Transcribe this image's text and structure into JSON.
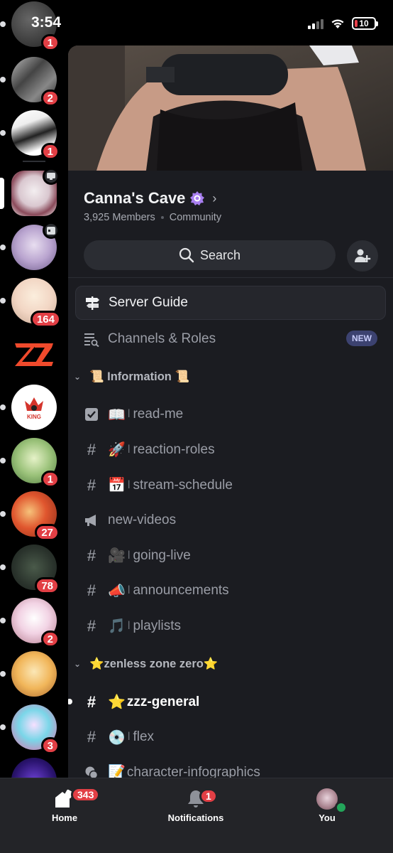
{
  "status_bar": {
    "time": "3:54",
    "battery": "10"
  },
  "server_rail": [
    {
      "badge": "1"
    },
    {
      "badge": "2"
    },
    {
      "badge": "1"
    },
    {
      "badge": ""
    },
    {
      "badge": ""
    },
    {
      "badge": "164"
    },
    {
      "badge": ""
    },
    {
      "badge": "",
      "logo_text": "KING"
    },
    {
      "badge": "1"
    },
    {
      "badge": "27"
    },
    {
      "badge": "78"
    },
    {
      "badge": "2"
    },
    {
      "badge": ""
    },
    {
      "badge": "3"
    }
  ],
  "server": {
    "name": "Canna's Cave",
    "members": "3,925 Members",
    "type": "Community",
    "search_label": "Search"
  },
  "channels": {
    "server_guide": "Server Guide",
    "channels_roles": "Channels & Roles",
    "new_pill": "NEW",
    "categories": [
      {
        "label": "📜 Information 📜",
        "items": [
          {
            "icon": "rules-icon",
            "emoji": "📖",
            "name": "read-me"
          },
          {
            "icon": "hash-icon",
            "emoji": "🚀",
            "name": "reaction-roles"
          },
          {
            "icon": "hash-icon",
            "emoji": "📅",
            "name": "stream-schedule"
          },
          {
            "icon": "announcement-icon",
            "emoji": "",
            "name": "new-videos"
          },
          {
            "icon": "hash-icon",
            "emoji": "🎥",
            "name": "going-live"
          },
          {
            "icon": "hash-icon",
            "emoji": "📣",
            "name": "announcements"
          },
          {
            "icon": "hash-icon",
            "emoji": "🎵",
            "name": "playlists"
          }
        ]
      },
      {
        "label": "⭐zenless zone zero⭐",
        "items": [
          {
            "icon": "hash-icon",
            "emoji": "⭐",
            "name": "zzz-general",
            "unread": true
          },
          {
            "icon": "hash-icon",
            "emoji": "💿",
            "name": "flex"
          },
          {
            "icon": "forum-icon",
            "emoji": "📝",
            "name": "character-infographics"
          }
        ]
      }
    ]
  },
  "bottom_nav": {
    "home": {
      "label": "Home",
      "badge": "343"
    },
    "notifications": {
      "label": "Notifications",
      "badge": "1"
    },
    "you": {
      "label": "You"
    }
  },
  "colors": {
    "panel_bg": "#1b1c21",
    "rail_bg": "#000000",
    "badge_red": "#e23f45",
    "nav_bg": "#232428",
    "online_green": "#23a55a"
  }
}
